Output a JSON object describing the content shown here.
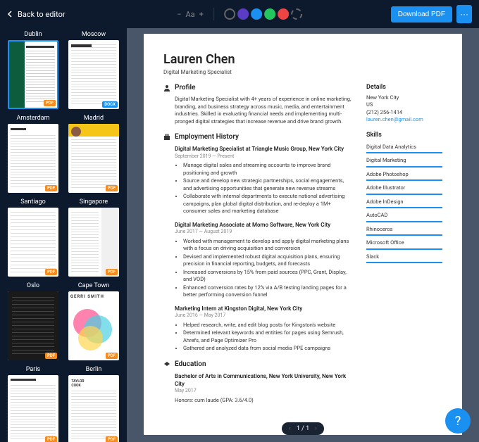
{
  "topbar": {
    "back": "Back to editor",
    "font_minus": "−",
    "font_label": "Aa",
    "font_plus": "+",
    "download": "Download PDF",
    "more": "···"
  },
  "colors": {
    "swatches": [
      "#5b3cc4",
      "#1a91f0",
      "#22c55e",
      "#ef4444"
    ]
  },
  "templates": [
    {
      "name": "Dublin",
      "badge": "PDF",
      "selected": true
    },
    {
      "name": "Moscow",
      "badge": "DOCX"
    },
    {
      "name": "Amsterdam",
      "badge": "PDF"
    },
    {
      "name": "Madrid",
      "badge": "PDF"
    },
    {
      "name": "Santiago",
      "badge": "PDF"
    },
    {
      "name": "Singapore",
      "badge": "PDF"
    },
    {
      "name": "Oslo",
      "badge": "PDF"
    },
    {
      "name": "Cape Town",
      "badge": "PDF"
    },
    {
      "name": "Paris",
      "badge": "PDF"
    },
    {
      "name": "Berlin",
      "badge": "PDF"
    }
  ],
  "resume": {
    "name": "Lauren Chen",
    "title": "Digital Marketing Specialist",
    "profile_heading": "Profile",
    "profile": "Digital Marketing Specialist with 4+ years of experience in online marketing, branding, and business strategy across music, media, and entertainment industries. Skilled in evaluating financial needs and implementing multi-pronged digital strategies that increase revenue and drive brand growth.",
    "employment_heading": "Employment History",
    "jobs": [
      {
        "title": "Digital Marketing Specialist at Triangle Music Group, New York City",
        "date": "September 2019 — Present",
        "bullets": [
          "Manage digital sales and streaming accounts to improve brand positioning and growth",
          "Source and develop new strategic partnerships, social engagements, and advertising opportunities that generate new revenue streams",
          "Collaborate with internal departments to execute national advertising campaigns, plan global digital distribution, and re-deploy a 1M+ consumer sales and marketing database"
        ]
      },
      {
        "title": "Digital Marketing Associate at Momo Software, New York City",
        "date": "June 2017 — August 2019",
        "bullets": [
          "Worked with management to develop and apply digital marketing plans with a focus on driving acquisition and conversion",
          "Devised and implemented robust digital acquisition plans, ensuring precision in financial reporting, budgets, and forecasts",
          "Increased conversions by 15% from paid sources (PPC, Grant, Display, and VOD)",
          "Enhanced conversion rates by 12% via A/B testing landing pages for a better performing conversion funnel"
        ]
      },
      {
        "title": "Marketing Intern at Kingston Digital, New York City",
        "date": "June 2016 — May 2017",
        "bullets": [
          "Helped research, write, and edit blog posts for Kingston's website",
          "Determined relevant keywords and entities for pages using Semrush, Ahrefs, and Page Optimizer Pro",
          "Gathered and analyzed data from social media PPE campaigns"
        ]
      }
    ],
    "education_heading": "Education",
    "education": {
      "title": "Bachelor of Arts in Communications, New York University, New York City",
      "date": "May 2017",
      "honors": "Honors: cum laude (GPA: 3.6/4.0)"
    },
    "details_heading": "Details",
    "details": {
      "city": "New York City",
      "country": "US",
      "phone": "(212) 256-1414",
      "email": "lauren.chen@gmail.com"
    },
    "skills_heading": "Skills",
    "skills": [
      "Digital Data Analytics",
      "Digital Marketing",
      "Adobe Photoshop",
      "Adobe Illustrator",
      "Adobe InDesign",
      "AutoCAD",
      "Rhinoceros",
      "Microsoft Office",
      "Slack"
    ]
  },
  "pager": {
    "prev": "‹",
    "label": "1 / 1",
    "next": "›"
  },
  "help": "?"
}
